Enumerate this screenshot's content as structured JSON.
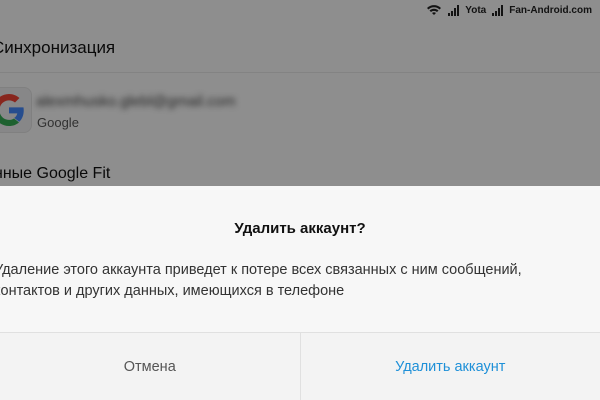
{
  "status_bar": {
    "carrier": "Yota",
    "site": "Fan-Android.com"
  },
  "page": {
    "title": "Синхронизация"
  },
  "account": {
    "email": "alexmhusko.glebl@gmail.com",
    "provider": "Google",
    "icon": "google-logo-icon"
  },
  "list": {
    "google_fit_label": "нные Google Fit"
  },
  "dialog": {
    "title": "Удалить аккаунт?",
    "message": "Удаление этого аккаунта приведет к потере всех связанных с ним сообщений, контактов и других данных, имеющихся в телефоне",
    "cancel_label": "Отмена",
    "confirm_label": "Удалить аккаунт"
  },
  "colors": {
    "accent": "#1e90d8",
    "overlay": "rgba(0,0,0,0.42)"
  }
}
